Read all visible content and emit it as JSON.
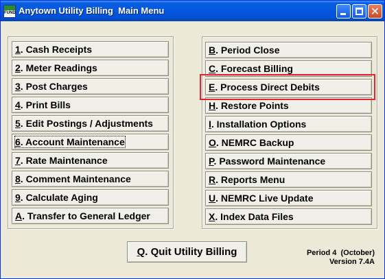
{
  "window": {
    "title": "Anytown Utility Billing  Main Menu",
    "app_icon_text": "FUND"
  },
  "left_menu": [
    {
      "key": "1",
      "label": ". Cash Receipts"
    },
    {
      "key": "2",
      "label": ". Meter Readings"
    },
    {
      "key": "3",
      "label": ". Post Charges"
    },
    {
      "key": "4",
      "label": ". Print Bills"
    },
    {
      "key": "5",
      "label": ". Edit Postings / Adjustments"
    },
    {
      "key": "6",
      "label": ". Account Maintenance"
    },
    {
      "key": "7",
      "label": ". Rate Maintenance"
    },
    {
      "key": "8",
      "label": ". Comment Maintenance"
    },
    {
      "key": "9",
      "label": ". Calculate Aging"
    },
    {
      "key": "A",
      "label": ". Transfer to General Ledger"
    }
  ],
  "right_menu": [
    {
      "key": "B",
      "label": ". Period Close"
    },
    {
      "key": "C",
      "label": ". Forecast Billing"
    },
    {
      "key": "E",
      "label": ". Process Direct Debits"
    },
    {
      "key": "H",
      "label": ". Restore Points"
    },
    {
      "key": "I",
      "label": ".  Installation Options"
    },
    {
      "key": "O",
      "label": ". NEMRC Backup"
    },
    {
      "key": "P",
      "label": ". Password Maintenance"
    },
    {
      "key": "R",
      "label": ". Reports Menu"
    },
    {
      "key": "U",
      "label": ". NEMRC Live Update"
    },
    {
      "key": "X",
      "label": ". Index Data Files"
    }
  ],
  "quit": {
    "key": "Q",
    "label": ". Quit Utility Billing"
  },
  "status": {
    "period": "Period 4  (October)",
    "version": "Version 7.4A"
  },
  "colors": {
    "highlight": "#e8212c",
    "titlebar": "#0458e2"
  }
}
